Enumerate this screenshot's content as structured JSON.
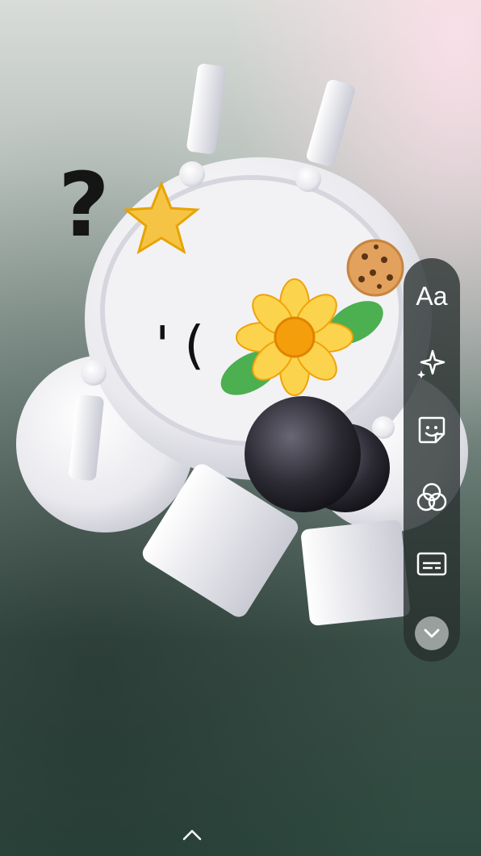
{
  "toolbar": {
    "text_label": "Aa",
    "items": [
      {
        "icon": "text-icon"
      },
      {
        "icon": "sparkle-icon"
      },
      {
        "icon": "sticker-icon"
      },
      {
        "icon": "filter-icon"
      },
      {
        "icon": "captions-icon"
      },
      {
        "icon": "chevron-down-icon"
      }
    ]
  },
  "canvas": {
    "face_text": "'( ·<",
    "question_mark": "?"
  },
  "bottom": {
    "icon": "chevron-up-icon"
  },
  "colors": {
    "toolbar_bg": "#28302e",
    "more_button_bg": "#9aa09e",
    "sticker_white": "#f2f2f4",
    "flower_petal": "#fcd34d",
    "flower_center": "#f59e0b",
    "leaf": "#4caf50",
    "ball_dark": "#2b2a33",
    "cookie": "#e2a15c",
    "star": "#f6c445"
  }
}
